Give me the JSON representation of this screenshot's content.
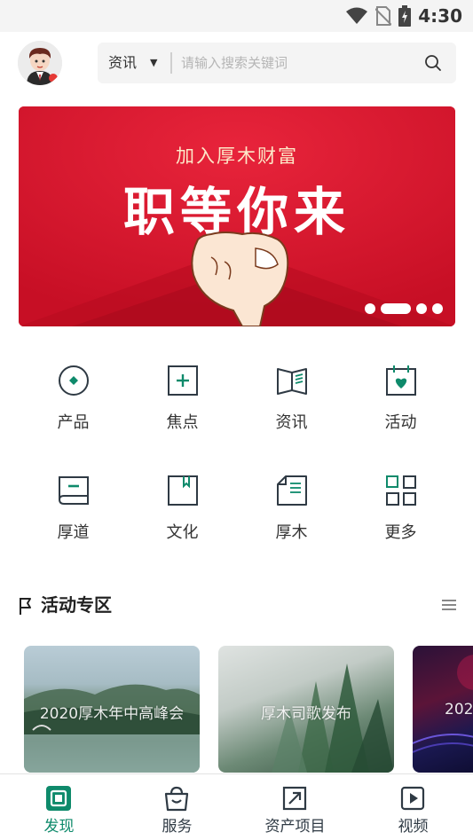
{
  "status_bar": {
    "time": "4:30",
    "icons": [
      "wifi-icon",
      "no-sim-icon",
      "battery-charging-icon"
    ]
  },
  "header": {
    "avatar": "avatar",
    "search": {
      "category": "资讯",
      "placeholder": "请输入搜索关键词",
      "icon": "search-icon"
    }
  },
  "banner": {
    "subtitle": "加入厚木财富",
    "title": "职等你来",
    "slide_count": 4,
    "active_slide": 1
  },
  "grid": {
    "items": [
      {
        "label": "产品",
        "icon": "product-icon"
      },
      {
        "label": "焦点",
        "icon": "focus-icon"
      },
      {
        "label": "资讯",
        "icon": "news-book-icon"
      },
      {
        "label": "活动",
        "icon": "calendar-heart-icon"
      },
      {
        "label": "厚道",
        "icon": "notebook-icon"
      },
      {
        "label": "文化",
        "icon": "bookmark-icon"
      },
      {
        "label": "厚木",
        "icon": "document-icon"
      },
      {
        "label": "更多",
        "icon": "more-grid-icon"
      }
    ]
  },
  "section": {
    "title": "活动专区",
    "flag_icon": "flag-icon",
    "menu_icon": "menu-icon"
  },
  "cards": [
    {
      "caption": "2020厚木年中高峰会"
    },
    {
      "caption": "厚木司歌发布"
    },
    {
      "caption": "202"
    }
  ],
  "bottom_nav": {
    "items": [
      {
        "label": "发现",
        "icon": "discover-icon",
        "active": true
      },
      {
        "label": "服务",
        "icon": "service-bag-icon",
        "active": false
      },
      {
        "label": "资产项目",
        "icon": "asset-project-icon",
        "active": false
      },
      {
        "label": "视频",
        "icon": "video-play-icon",
        "active": false
      }
    ]
  },
  "colors": {
    "accent": "#0e8a6b",
    "banner_red": "#d9142c",
    "icon_dark": "#2f3a44"
  }
}
